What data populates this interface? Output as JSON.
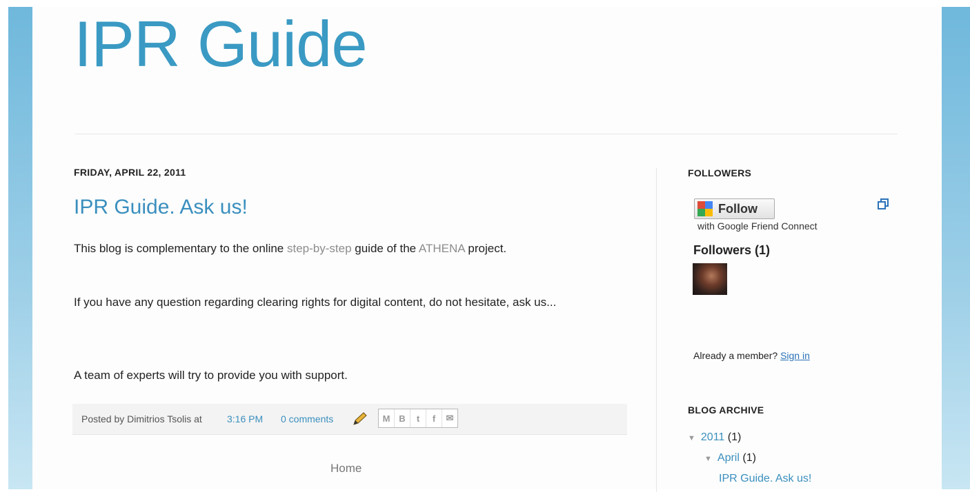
{
  "blog": {
    "title": "IPR Guide"
  },
  "post": {
    "date_header": "FRIDAY, APRIL 22, 2011",
    "title": "IPR Guide. Ask us!",
    "p1_before": "This blog is complementary to the online ",
    "p1_link1": "step-by-step",
    "p1_middle": " guide of the ",
    "p1_link2": "ATHENA",
    "p1_after": " project.",
    "p2": "If you have any question regarding clearing rights for digital content, do not hesitate, ask us...",
    "p3": "A team of experts will try to provide you with support.",
    "footer": {
      "posted_by": "Posted by Dimitrios Tsolis at",
      "time": "3:16 PM",
      "comments": "0 comments"
    },
    "share_buttons": [
      {
        "icon": "email-icon",
        "glyph": "M"
      },
      {
        "icon": "blogger-icon",
        "glyph": "B"
      },
      {
        "icon": "twitter-icon",
        "glyph": "t"
      },
      {
        "icon": "facebook-icon",
        "glyph": "f"
      },
      {
        "icon": "buzz-icon",
        "glyph": "✉"
      }
    ]
  },
  "nav": {
    "home": "Home"
  },
  "sidebar": {
    "followers_title": "FOLLOWERS",
    "follow_button": "Follow",
    "gfc_sub": "with Google Friend Connect",
    "followers_count": "Followers (1)",
    "member_prompt": "Already a member?",
    "sign_in": "Sign in",
    "archive_title": "BLOG ARCHIVE",
    "archive": {
      "year": "2011",
      "year_count": "(1)",
      "month": "April",
      "month_count": "(1)",
      "post": "IPR Guide. Ask us!"
    }
  },
  "colors": {
    "accent": "#3a9ac3",
    "link": "#3a8fbe",
    "outer_bg": "#6fb8dc"
  }
}
